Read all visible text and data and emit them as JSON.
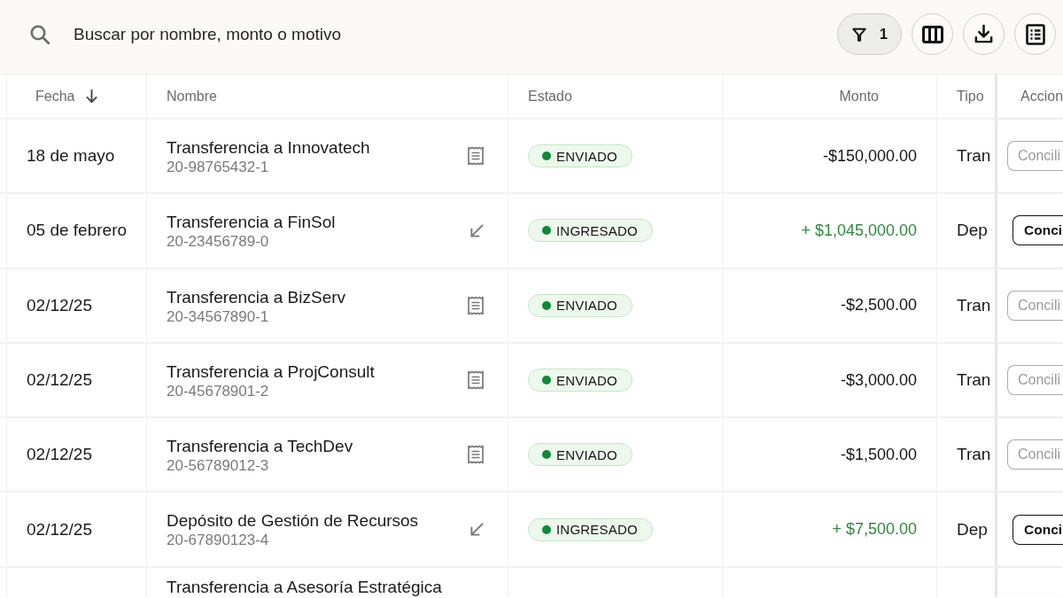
{
  "search": {
    "placeholder": "Buscar por nombre, monto o motivo"
  },
  "filter": {
    "count": "1"
  },
  "table": {
    "columns": [
      {
        "label": "Fecha",
        "kind": "date",
        "sorted": true
      },
      {
        "label": "Nombre",
        "kind": "name",
        "sorted": false
      },
      {
        "label": "Estado",
        "kind": "status",
        "sorted": false
      },
      {
        "label": "Monto",
        "kind": "amount",
        "sorted": false
      },
      {
        "label": "Tipo",
        "kind": "type",
        "sorted": false
      },
      {
        "label": "Accion",
        "kind": "action",
        "sorted": false
      }
    ],
    "rows": [
      {
        "kind": "outgoing",
        "date": "18 de mayo",
        "name": "Transferencia a Innovatech",
        "account": "20-98765432-1",
        "status": "ENVIADO",
        "amount": "-$150,000.00",
        "type": "Tran",
        "action": {
          "label": "Concili",
          "disabled": true
        }
      },
      {
        "kind": "incoming",
        "date": "05 de febrero",
        "name": "Transferencia a FinSol",
        "account": "20-23456789-0",
        "status": "INGRESADO",
        "amount": "+ $1,045,000.00",
        "type": "Dep",
        "action": {
          "label": "Conci",
          "disabled": false
        }
      },
      {
        "kind": "outgoing",
        "date": "02/12/25",
        "name": "Transferencia a BizServ",
        "account": "20-34567890-1",
        "status": "ENVIADO",
        "amount": "-$2,500.00",
        "type": "Tran",
        "action": {
          "label": "Concili",
          "disabled": true
        }
      },
      {
        "kind": "outgoing",
        "date": "02/12/25",
        "name": "Transferencia a ProjConsult",
        "account": "20-45678901-2",
        "status": "ENVIADO",
        "amount": "-$3,000.00",
        "type": "Tran",
        "action": {
          "label": "Concili",
          "disabled": true
        }
      },
      {
        "kind": "outgoing",
        "date": "02/12/25",
        "name": "Transferencia a TechDev",
        "account": "20-56789012-3",
        "status": "ENVIADO",
        "amount": "-$1,500.00",
        "type": "Tran",
        "action": {
          "label": "Concili",
          "disabled": true
        }
      },
      {
        "kind": "incoming",
        "date": "02/12/25",
        "name": "Depósito de Gestión de Recursos",
        "account": "20-67890123-4",
        "status": "INGRESADO",
        "amount": "+ $7,500.00",
        "type": "Dep",
        "action": {
          "label": "Conci",
          "disabled": false
        }
      },
      {
        "name": "Transferencia a Asesoría Estratégica"
      }
    ]
  }
}
